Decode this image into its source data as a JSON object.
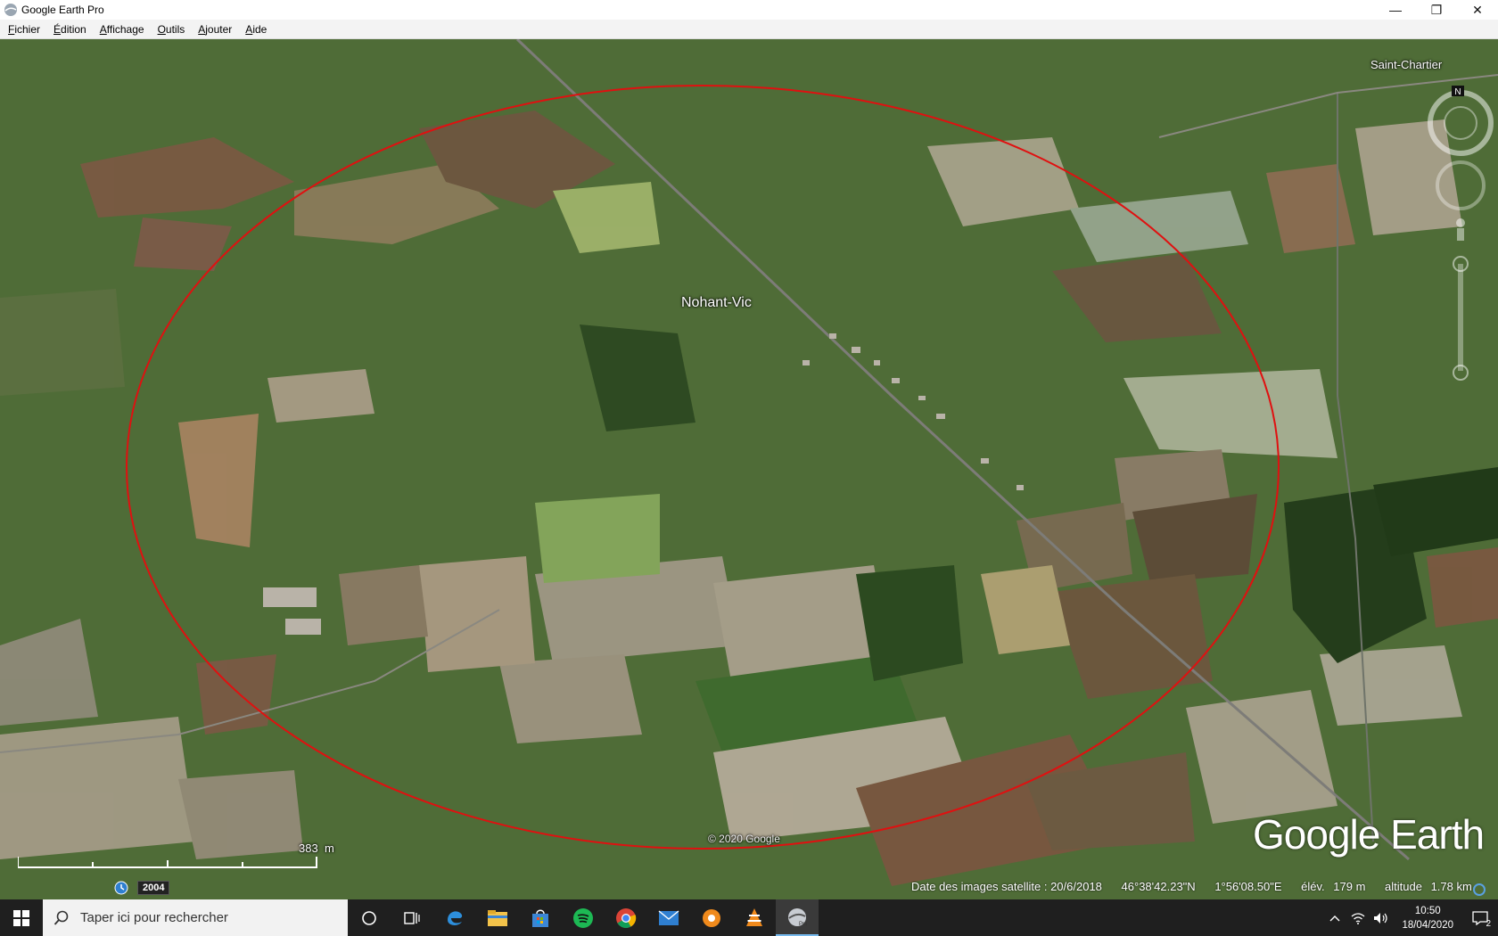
{
  "window": {
    "title": "Google Earth Pro",
    "minimize_symbol": "—",
    "maximize_symbol": "❐",
    "close_symbol": "✕"
  },
  "menu": [
    {
      "label": "Fichier",
      "mnemonic": "F",
      "rest": "ichier"
    },
    {
      "label": "Édition",
      "mnemonic": "É",
      "rest": "dition"
    },
    {
      "label": "Affichage",
      "mnemonic": "A",
      "rest": "ffichage"
    },
    {
      "label": "Outils",
      "mnemonic": "O",
      "rest": "utils"
    },
    {
      "label": "Ajouter",
      "mnemonic": "A",
      "rest": "jouter"
    },
    {
      "label": "Aide",
      "mnemonic": "A",
      "rest": "ide"
    }
  ],
  "map": {
    "places": {
      "nohant": "Nohant-Vic",
      "saint_chartier": "Saint-Chartier"
    },
    "copyright": "© 2020 Google",
    "brand": "Google Earth",
    "compass_north": "N",
    "circle_color": "#e01010",
    "scale": {
      "distance": "383",
      "unit": "m"
    },
    "imagery_year": "2004"
  },
  "status": {
    "imagery_date": "Date des images satellite : 20/6/2018",
    "latitude": "46°38'42.23\"N",
    "longitude": "1°56'08.50\"E",
    "elevation_label": "élév.",
    "elevation_value": "179 m",
    "altitude_label": "altitude",
    "altitude_value": "1.78 km"
  },
  "taskbar": {
    "search_placeholder": "Taper ici pour rechercher",
    "apps": [
      "cortana-icon",
      "task-view-icon",
      "edge-icon",
      "file-explorer-icon",
      "store-icon",
      "spotify-icon",
      "chrome-icon",
      "mail-icon",
      "vlc-settings-icon",
      "vlc-icon",
      "google-earth-icon"
    ],
    "clock_time": "10:50",
    "clock_date": "18/04/2020",
    "notification_count": "2",
    "accent_color": "#76b9ed"
  }
}
